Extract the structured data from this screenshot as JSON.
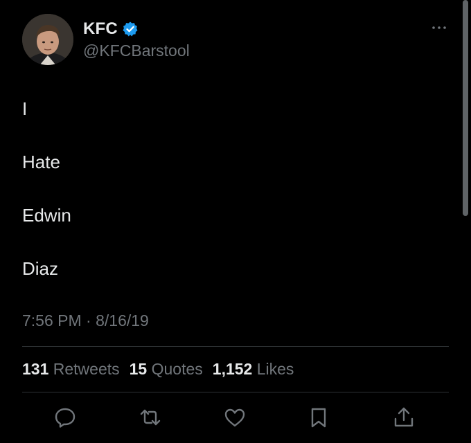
{
  "author": {
    "display_name": "KFC",
    "handle": "@KFCBarstool",
    "verified": true,
    "verified_color": "#1d9bf0"
  },
  "tweet": {
    "lines": [
      "I",
      "Hate",
      "Edwin",
      "Diaz"
    ],
    "timestamp": "7:56 PM · 8/16/19"
  },
  "stats": [
    {
      "count": "131",
      "label": "Retweets"
    },
    {
      "count": "15",
      "label": "Quotes"
    },
    {
      "count": "1,152",
      "label": "Likes"
    }
  ],
  "actions": [
    "reply-icon",
    "retweet-icon",
    "like-icon",
    "bookmark-icon",
    "share-icon"
  ],
  "colors": {
    "background": "#000000",
    "text": "#e7e9ea",
    "secondary_text": "#71767b",
    "divider": "#2f3336"
  }
}
